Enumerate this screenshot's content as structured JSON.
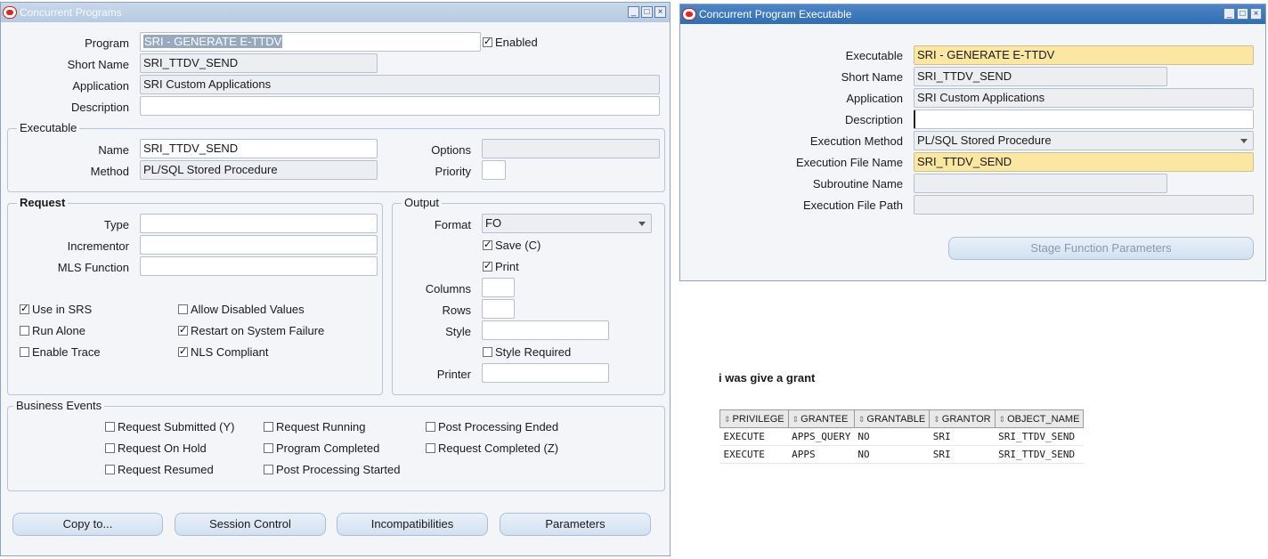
{
  "left_window": {
    "title": "Concurrent Programs",
    "program": {
      "label": "Program",
      "value": "SRI - GENERATE E-TTDV"
    },
    "enabled": {
      "label": "Enabled",
      "checked": true
    },
    "short_name": {
      "label": "Short Name",
      "value": "SRI_TTDV_SEND"
    },
    "application": {
      "label": "Application",
      "value": "SRI Custom Applications"
    },
    "description": {
      "label": "Description",
      "value": ""
    },
    "executable": {
      "title": "Executable",
      "name_label": "Name",
      "name_value": "SRI_TTDV_SEND",
      "method_label": "Method",
      "method_value": "PL/SQL Stored Procedure",
      "options_label": "Options",
      "options_value": "",
      "priority_label": "Priority",
      "priority_value": ""
    },
    "request": {
      "title": "Request",
      "type_label": "Type",
      "type_value": "",
      "incrementor_label": "Incrementor",
      "incrementor_value": "",
      "mls_label": "MLS Function",
      "mls_value": "",
      "checks": [
        {
          "label": "Use in SRS",
          "checked": true
        },
        {
          "label": "Allow Disabled Values",
          "checked": false
        },
        {
          "label": "Run Alone",
          "checked": false
        },
        {
          "label": "Restart on System Failure",
          "checked": true
        },
        {
          "label": "Enable Trace",
          "checked": false
        },
        {
          "label": "NLS Compliant",
          "checked": true
        }
      ]
    },
    "output": {
      "title": "Output",
      "format_label": "Format",
      "format_value": "FO",
      "save_label": "Save (C)",
      "save_checked": true,
      "print_label": "Print",
      "print_checked": true,
      "columns_label": "Columns",
      "columns_value": "",
      "rows_label": "Rows",
      "rows_value": "",
      "style_label": "Style",
      "style_value": "",
      "style_required_label": "Style Required",
      "style_required_checked": false,
      "printer_label": "Printer",
      "printer_value": ""
    },
    "business_events": {
      "title": "Business Events",
      "items": [
        {
          "label": "Request Submitted (Y)",
          "checked": false
        },
        {
          "label": "Request Running",
          "checked": false
        },
        {
          "label": "Post Processing Ended",
          "checked": false
        },
        {
          "label": "Request On Hold",
          "checked": false
        },
        {
          "label": "Program Completed",
          "checked": false
        },
        {
          "label": "Request Completed (Z)",
          "checked": false
        },
        {
          "label": "Request Resumed",
          "checked": false
        },
        {
          "label": "Post Processing Started",
          "checked": false
        }
      ]
    },
    "buttons": {
      "copy": "Copy to...",
      "session": "Session Control",
      "incompat": "Incompatibilities",
      "params": "Parameters"
    }
  },
  "right_window": {
    "title": "Concurrent Program Executable",
    "executable": {
      "label": "Executable",
      "value": "SRI - GENERATE E-TTDV"
    },
    "short_name": {
      "label": "Short Name",
      "value": "SRI_TTDV_SEND"
    },
    "application": {
      "label": "Application",
      "value": "SRI Custom Applications"
    },
    "description": {
      "label": "Description",
      "value": ""
    },
    "execution_method": {
      "label": "Execution Method",
      "value": "PL/SQL Stored Procedure"
    },
    "execution_file_name": {
      "label": "Execution File Name",
      "value": "SRI_TTDV_SEND"
    },
    "subroutine_name": {
      "label": "Subroutine Name",
      "value": ""
    },
    "execution_file_path": {
      "label": "Execution File Path",
      "value": ""
    },
    "stage_button": "Stage Function Parameters"
  },
  "note": "i was give a grant",
  "grant_table": {
    "columns": [
      "PRIVILEGE",
      "GRANTEE",
      "GRANTABLE",
      "GRANTOR",
      "OBJECT_NAME"
    ],
    "rows": [
      [
        "EXECUTE",
        "APPS_QUERY",
        "NO",
        "SRI",
        "SRI_TTDV_SEND"
      ],
      [
        "EXECUTE",
        "APPS",
        "NO",
        "SRI",
        "SRI_TTDV_SEND"
      ]
    ]
  },
  "colors": {
    "title_active": "#2f6db2",
    "required_field": "#fbe7a1",
    "oracle_red": "#d62b1e"
  },
  "icons": [
    "oracle-logo-icon",
    "minimize-icon",
    "maximize-icon",
    "close-icon",
    "dropdown-arrow-icon",
    "sort-icon"
  ]
}
